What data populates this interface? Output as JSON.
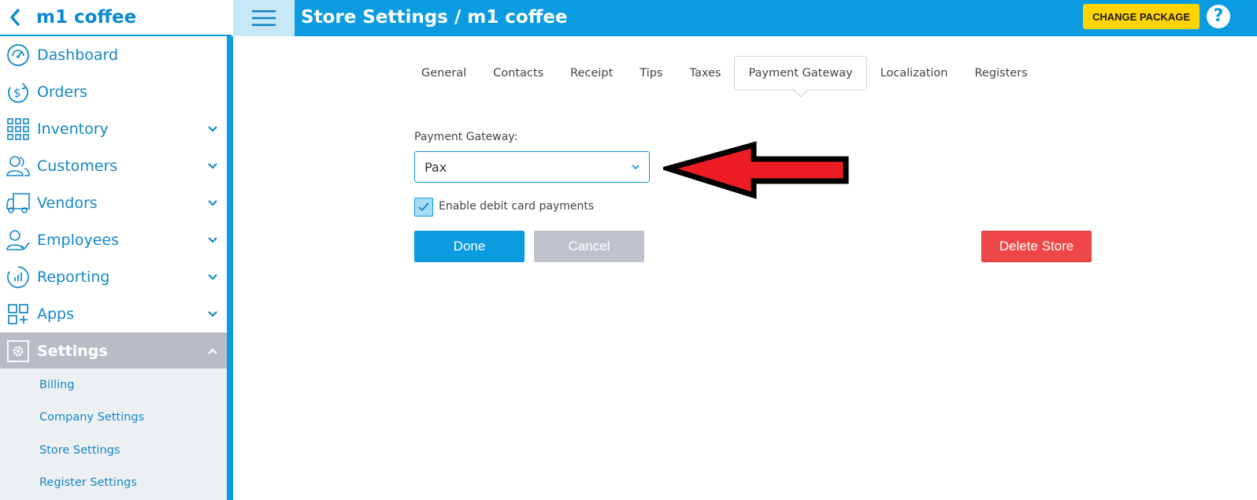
{
  "sidebar": {
    "store_name": "m1 coffee",
    "nav": [
      {
        "label": "Dashboard",
        "icon": "dashboard-icon"
      },
      {
        "label": "Orders",
        "icon": "dollar-refresh-icon"
      },
      {
        "label": "Inventory",
        "icon": "grid-icon"
      },
      {
        "label": "Customers",
        "icon": "users-icon"
      },
      {
        "label": "Vendors",
        "icon": "truck-icon"
      },
      {
        "label": "Employees",
        "icon": "employee-icon"
      },
      {
        "label": "Reporting",
        "icon": "chart-icon"
      },
      {
        "label": "Apps",
        "icon": "apps-icon"
      },
      {
        "label": "Settings",
        "icon": "gear-icon"
      }
    ],
    "subnav": [
      "Billing",
      "Company Settings",
      "Store Settings",
      "Register Settings"
    ]
  },
  "topbar": {
    "title": "Store Settings / m1 coffee",
    "change_package": "CHANGE PACKAGE",
    "help": "?"
  },
  "tabs": [
    "General",
    "Contacts",
    "Receipt",
    "Tips",
    "Taxes",
    "Payment Gateway",
    "Localization",
    "Registers"
  ],
  "active_tab": "Payment Gateway",
  "form": {
    "gateway_label": "Payment Gateway:",
    "gateway_value": "Pax",
    "debit_label": "Enable debit card payments",
    "debit_checked": true
  },
  "buttons": {
    "done": "Done",
    "cancel": "Cancel",
    "delete": "Delete Store"
  },
  "colors": {
    "primary": "#0a9be0",
    "accent_yellow": "#ffd400",
    "danger": "#ef4747",
    "arrow_red": "#ee1c25"
  }
}
